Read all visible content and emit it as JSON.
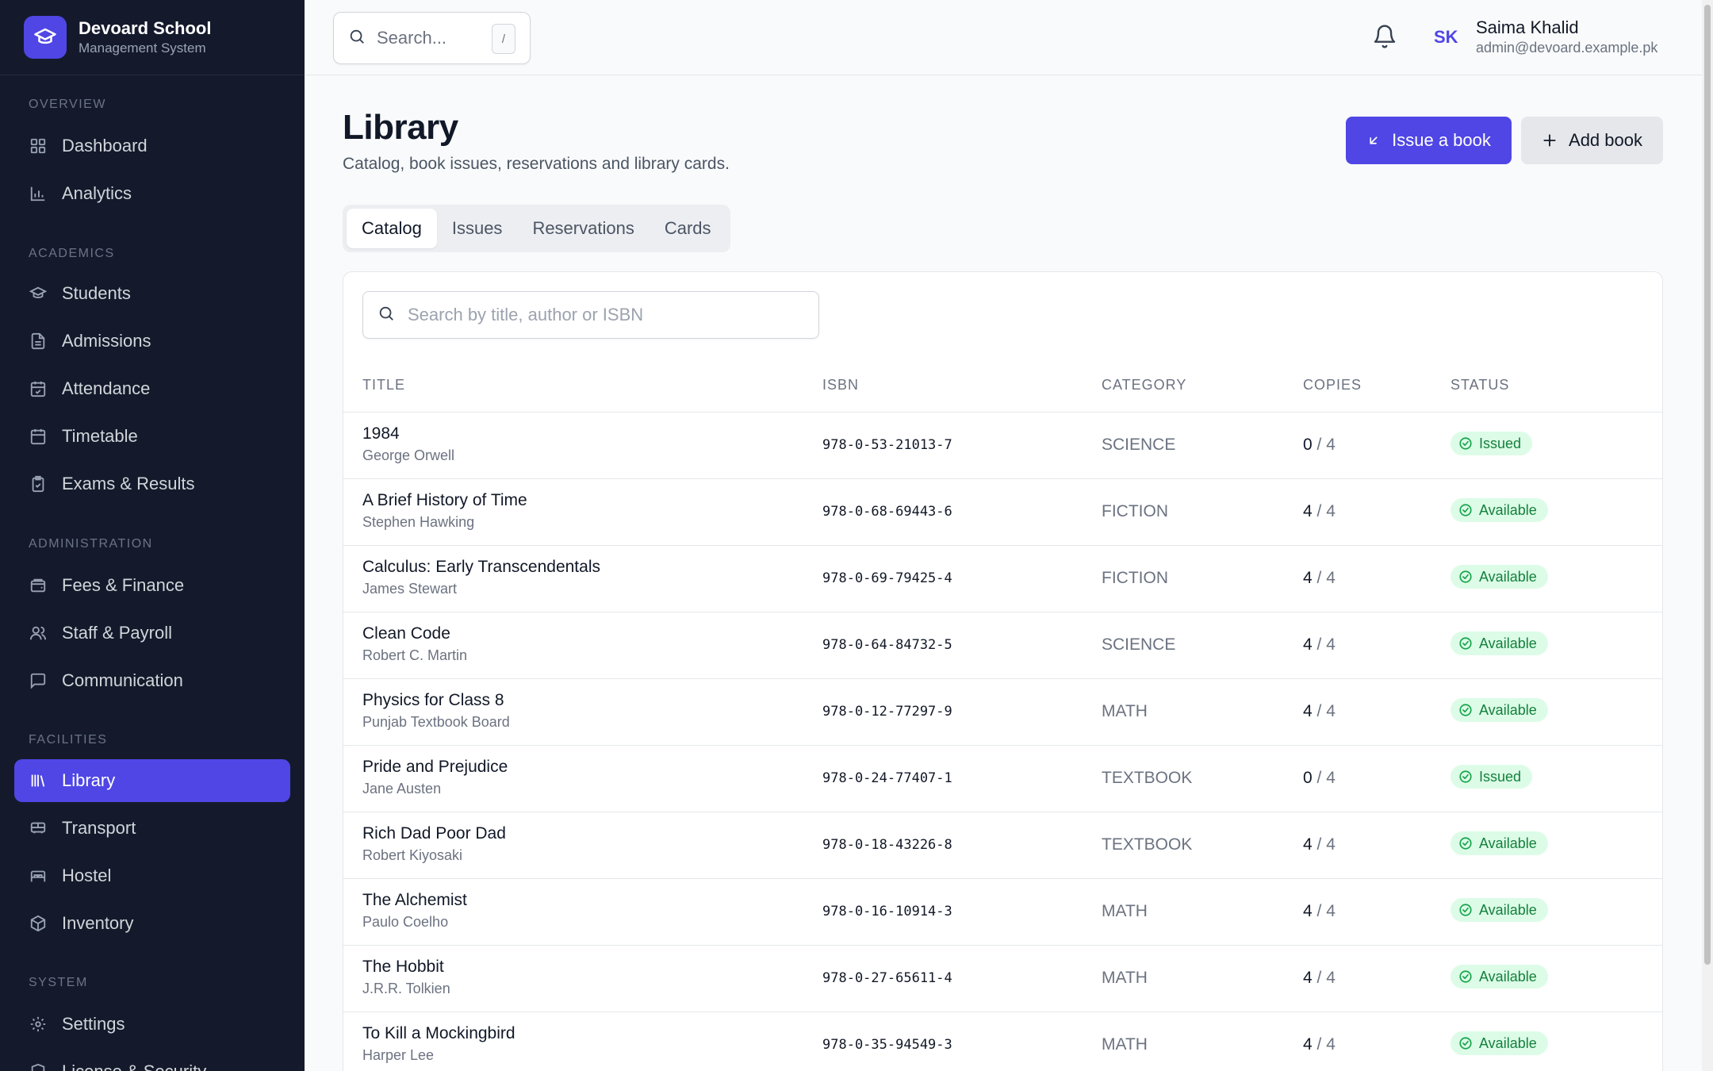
{
  "brand": {
    "name": "Devoard School",
    "subtitle": "Management System"
  },
  "sidebar": {
    "sections": [
      {
        "label": "OVERVIEW"
      },
      {
        "label": "ACADEMICS"
      },
      {
        "label": "ADMINISTRATION"
      },
      {
        "label": "FACILITIES"
      },
      {
        "label": "SYSTEM"
      }
    ],
    "items": [
      {
        "label": "Dashboard",
        "icon": "grid-icon"
      },
      {
        "label": "Analytics",
        "icon": "bar-chart-icon"
      },
      {
        "label": "Students",
        "icon": "graduation-cap-icon"
      },
      {
        "label": "Admissions",
        "icon": "document-icon"
      },
      {
        "label": "Attendance",
        "icon": "calendar-check-icon"
      },
      {
        "label": "Timetable",
        "icon": "calendar-icon"
      },
      {
        "label": "Exams & Results",
        "icon": "clipboard-check-icon"
      },
      {
        "label": "Fees & Finance",
        "icon": "wallet-icon"
      },
      {
        "label": "Staff & Payroll",
        "icon": "users-icon"
      },
      {
        "label": "Communication",
        "icon": "message-icon"
      },
      {
        "label": "Library",
        "icon": "library-icon",
        "active": true
      },
      {
        "label": "Transport",
        "icon": "bus-icon"
      },
      {
        "label": "Hostel",
        "icon": "bed-icon"
      },
      {
        "label": "Inventory",
        "icon": "package-icon"
      },
      {
        "label": "Settings",
        "icon": "gear-icon"
      },
      {
        "label": "License & Security",
        "icon": "shield-icon"
      }
    ]
  },
  "topbar": {
    "search_placeholder": "Search...",
    "shortcut": "/",
    "user": {
      "initials": "SK",
      "name": "Saima Khalid",
      "email": "admin@devoard.example.pk"
    }
  },
  "page": {
    "title": "Library",
    "subtitle": "Catalog, book issues, reservations and library cards.",
    "primary_action": "Issue a book",
    "secondary_action": "Add book",
    "tabs": [
      "Catalog",
      "Issues",
      "Reservations",
      "Cards"
    ],
    "active_tab": "Catalog"
  },
  "catalog": {
    "search_placeholder": "Search by title, author or ISBN",
    "columns": [
      "TITLE",
      "ISBN",
      "CATEGORY",
      "COPIES",
      "STATUS"
    ],
    "rows": [
      {
        "title": "1984",
        "author": "George Orwell",
        "isbn": "978-0-53-21013-7",
        "category": "SCIENCE",
        "available": "0",
        "total": "/ 4",
        "status": "Issued"
      },
      {
        "title": "A Brief History of Time",
        "author": "Stephen Hawking",
        "isbn": "978-0-68-69443-6",
        "category": "FICTION",
        "available": "4",
        "total": "/ 4",
        "status": "Available"
      },
      {
        "title": "Calculus: Early Transcendentals",
        "author": "James Stewart",
        "isbn": "978-0-69-79425-4",
        "category": "FICTION",
        "available": "4",
        "total": "/ 4",
        "status": "Available"
      },
      {
        "title": "Clean Code",
        "author": "Robert C. Martin",
        "isbn": "978-0-64-84732-5",
        "category": "SCIENCE",
        "available": "4",
        "total": "/ 4",
        "status": "Available"
      },
      {
        "title": "Physics for Class 8",
        "author": "Punjab Textbook Board",
        "isbn": "978-0-12-77297-9",
        "category": "MATH",
        "available": "4",
        "total": "/ 4",
        "status": "Available"
      },
      {
        "title": "Pride and Prejudice",
        "author": "Jane Austen",
        "isbn": "978-0-24-77407-1",
        "category": "TEXTBOOK",
        "available": "0",
        "total": "/ 4",
        "status": "Issued"
      },
      {
        "title": "Rich Dad Poor Dad",
        "author": "Robert Kiyosaki",
        "isbn": "978-0-18-43226-8",
        "category": "TEXTBOOK",
        "available": "4",
        "total": "/ 4",
        "status": "Available"
      },
      {
        "title": "The Alchemist",
        "author": "Paulo Coelho",
        "isbn": "978-0-16-10914-3",
        "category": "MATH",
        "available": "4",
        "total": "/ 4",
        "status": "Available"
      },
      {
        "title": "The Hobbit",
        "author": "J.R.R. Tolkien",
        "isbn": "978-0-27-65611-4",
        "category": "MATH",
        "available": "4",
        "total": "/ 4",
        "status": "Available"
      },
      {
        "title": "To Kill a Mockingbird",
        "author": "Harper Lee",
        "isbn": "978-0-35-94549-3",
        "category": "MATH",
        "available": "4",
        "total": "/ 4",
        "status": "Available"
      }
    ]
  },
  "colors": {
    "accent": "#4f46e5",
    "sidebar_bg": "#141a2b",
    "badge_bg": "#dcfce7",
    "badge_fg": "#15803d"
  }
}
